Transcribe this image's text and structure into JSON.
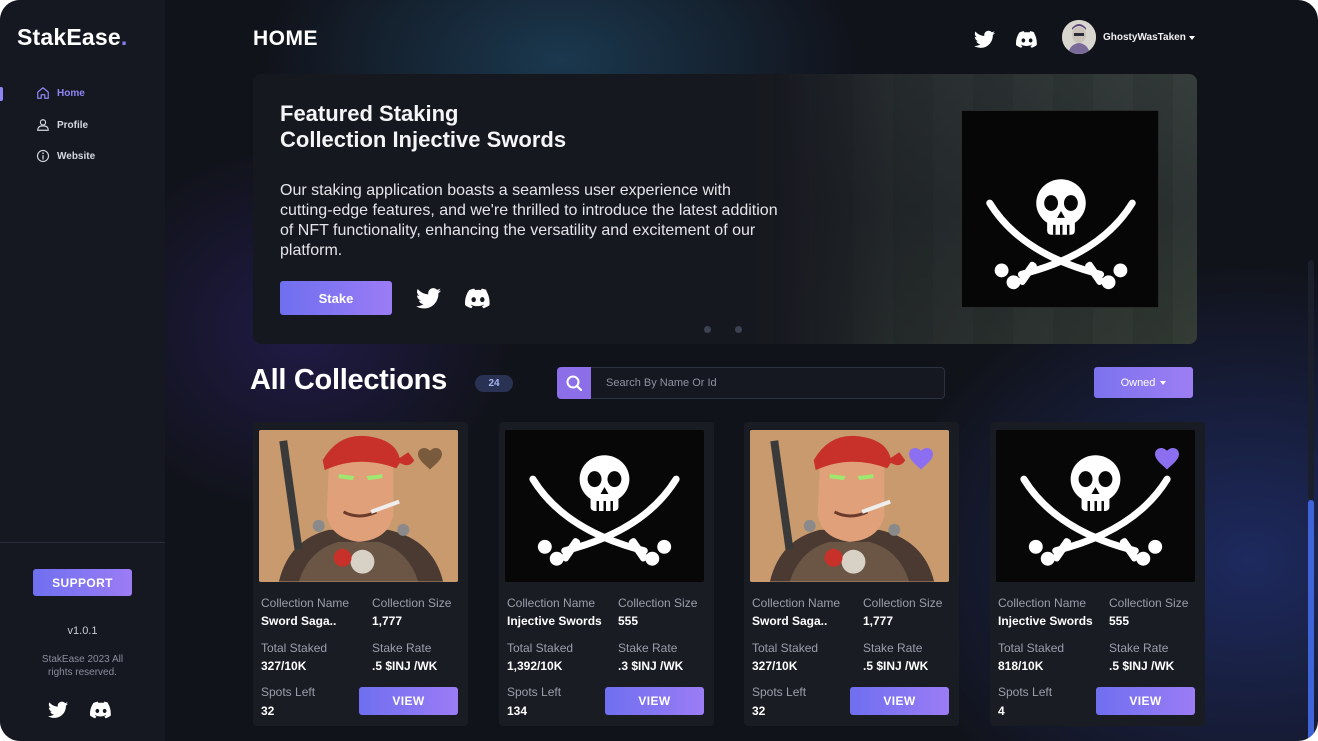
{
  "app": {
    "logo_text": "StakEase",
    "logo_dot": ".",
    "accent_color": "#8e86f5",
    "button_gradient": [
      "#6f6ff0",
      "#9b7cf5"
    ]
  },
  "sidebar": {
    "items": [
      {
        "label": "Home",
        "icon": "home-icon",
        "active": true
      },
      {
        "label": "Profile",
        "icon": "user-icon",
        "active": false
      },
      {
        "label": "Website",
        "icon": "info-icon",
        "active": false
      }
    ],
    "support_label": "SUPPORT",
    "version": "v1.0.1",
    "copyright_line1": "StakEase 2023 All",
    "copyright_line2": "rights reserved.",
    "social_icons": [
      "twitter-icon",
      "discord-icon"
    ]
  },
  "header": {
    "title": "HOME",
    "username": "GhostyWasTaken",
    "icons": [
      "twitter-icon",
      "discord-icon",
      "chevron-down-icon"
    ]
  },
  "banner": {
    "title_line1": "Featured Staking",
    "title_line2": "Collection Injective Swords",
    "description": "Our staking application boasts a seamless user experience with cutting-edge features, and we're thrilled to introduce the latest addition of NFT functionality, enhancing the versatility and excitement of our platform.",
    "stake_label": "Stake",
    "image": "pirate-flag-image",
    "pager_dots": 2,
    "active_dot": 0
  },
  "collections": {
    "title": "All Collections",
    "count": "24",
    "search_placeholder": "Search By Name Or Id",
    "filter_label": "Owned",
    "field_labels": {
      "name": "Collection Name",
      "size": "Collection Size",
      "staked": "Total Staked",
      "rate": "Stake Rate",
      "spots": "Spots Left"
    },
    "view_label": "VIEW",
    "cards": [
      {
        "name": "Sword Saga..",
        "size": "1,777",
        "staked": "327/10K",
        "rate": ".5 $INJ /WK",
        "spots": "32",
        "image": "pirate-portrait",
        "favorited": false,
        "heart_color": "#7a5a3c"
      },
      {
        "name": "Injective Swords",
        "size": "555",
        "staked": "1,392/10K",
        "rate": ".3 $INJ /WK",
        "spots": "134",
        "image": "pirate-flag",
        "favorited": false,
        "heart_color": ""
      },
      {
        "name": "Sword Saga..",
        "size": "1,777",
        "staked": "327/10K",
        "rate": ".5 $INJ /WK",
        "spots": "32",
        "image": "pirate-portrait",
        "favorited": true,
        "heart_color": "#8c6ff0"
      },
      {
        "name": "Injective Swords",
        "size": "555",
        "staked": "818/10K",
        "rate": ".5 $INJ /WK",
        "spots": "4",
        "image": "pirate-flag",
        "favorited": true,
        "heart_color": "#8c6ff0"
      }
    ]
  }
}
